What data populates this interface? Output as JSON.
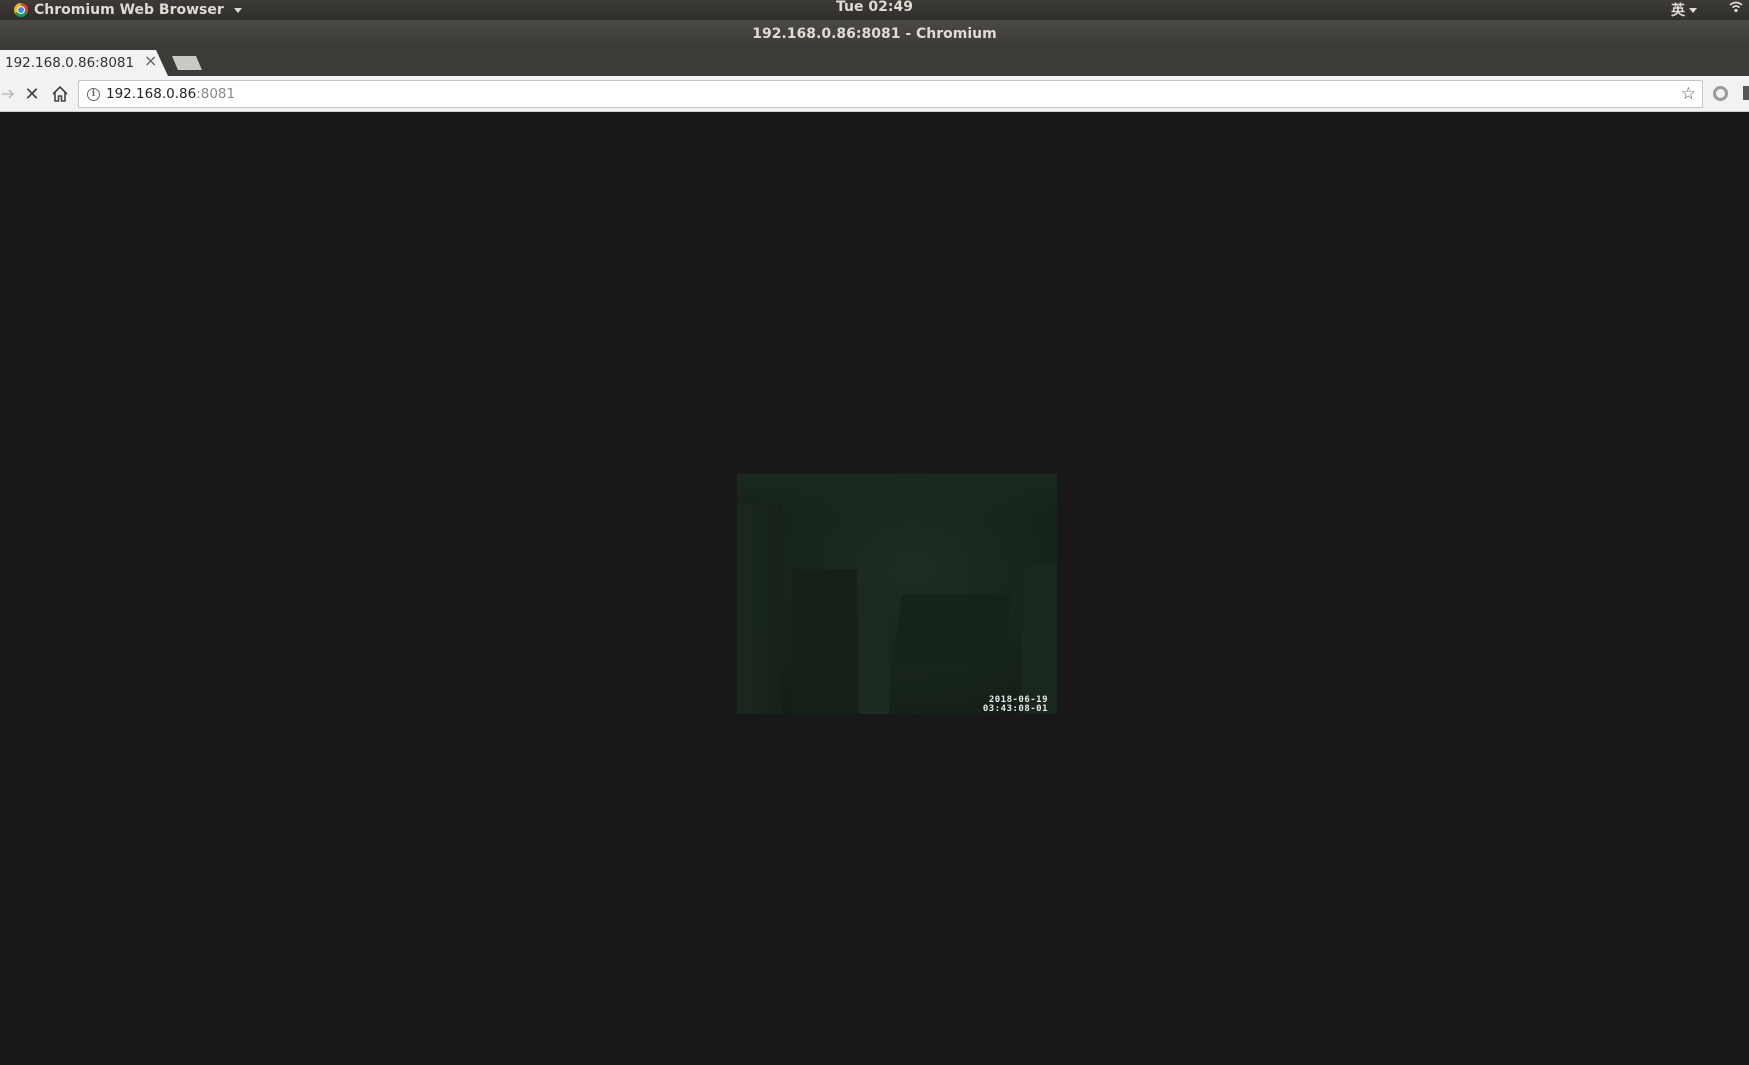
{
  "top_panel": {
    "app_name": "Chromium Web Browser",
    "clock": "Tue 02:49",
    "ime": "英"
  },
  "window": {
    "title": "192.168.0.86:8081 - Chromium"
  },
  "tabs": [
    {
      "label": "192.168.0.86:8081",
      "close": "×"
    }
  ],
  "toolbar": {
    "url_host": "192.168.0.86",
    "url_port": ":8081",
    "info_glyph": "i",
    "stop_glyph": "✕",
    "star_glyph": "☆"
  },
  "stream": {
    "date": "2018-06-19",
    "time": "03:43:08-01"
  },
  "icons": [
    "chromium-logo-icon",
    "wifi-icon",
    "forward-icon",
    "stop-icon",
    "home-icon",
    "info-icon",
    "star-icon",
    "extension-icon",
    "close-icon"
  ]
}
